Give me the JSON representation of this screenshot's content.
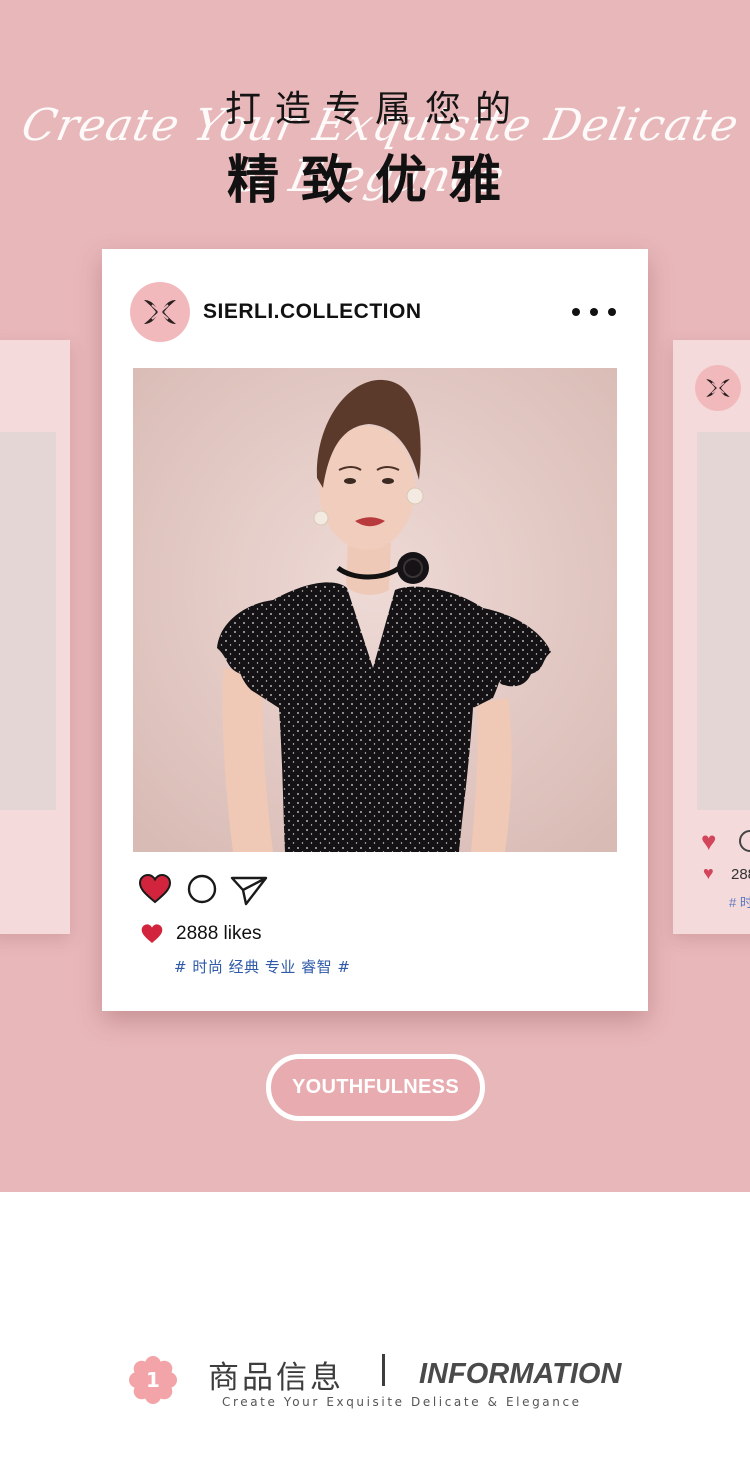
{
  "header": {
    "title_cn_line1": "打造专属您的",
    "title_script": "Create Your Exquisite Delicate & Elegance",
    "title_cn_line2": "精致优雅"
  },
  "post": {
    "username": "SIERLI.COLLECTION",
    "avatar_icon": "sierli-logo-icon",
    "actions": [
      "heart-icon",
      "comment-icon",
      "share-icon"
    ],
    "likes": "2888 likes",
    "tags": "# 时尚 经典 专业 睿智 #"
  },
  "side_card": {
    "likes_partial": "288",
    "tags_partial": "# 时"
  },
  "button": {
    "label": "YOUTHFULNESS"
  },
  "info": {
    "badge_number": "1",
    "title_cn": "商品信息",
    "title_en": "INFORMATION",
    "subtitle": "Create Your Exquisite Delicate & Elegance"
  },
  "colors": {
    "hero_bg": "#e8b7b9",
    "card_bg": "#ffffff",
    "accent_red": "#d2253d",
    "tag_blue": "#2e5aa8",
    "avatar_pink": "#f2b9bd"
  }
}
